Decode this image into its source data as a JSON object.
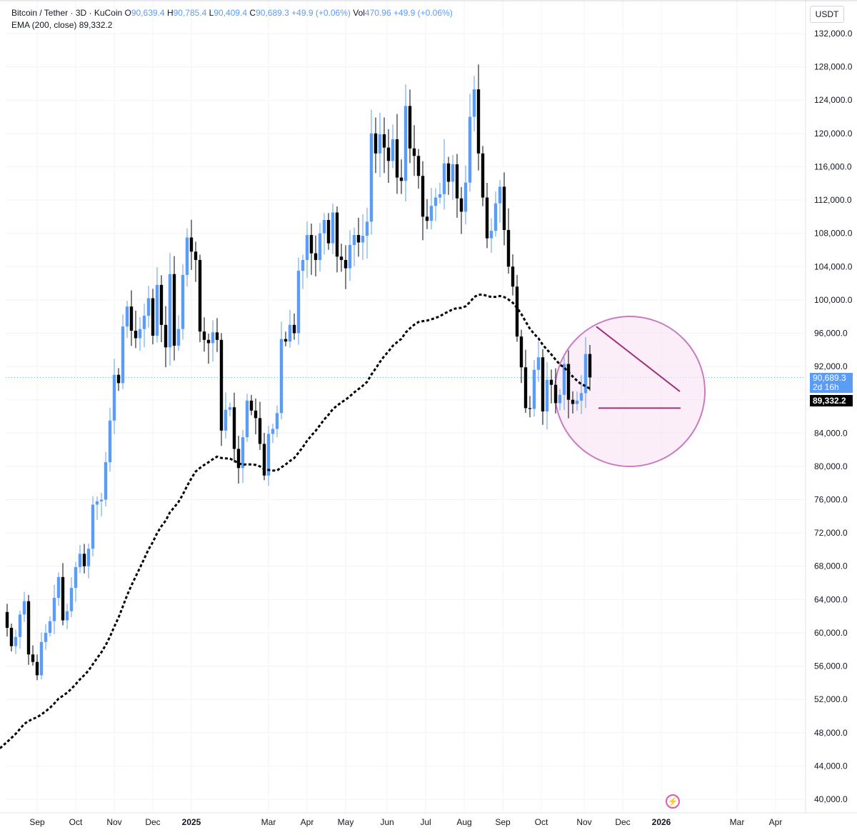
{
  "legend": {
    "symbol": "Bitcoin / Tether · 3D · KuCoin",
    "open_label": "O",
    "open": "90,639.4",
    "high_label": "H",
    "high": "90,785.4",
    "low_label": "L",
    "low": "90,409.4",
    "close_label": "C",
    "close": "90,689.3",
    "change": "+49.9 (+0.06%)",
    "vol_label": "Vol",
    "vol": "470.96",
    "vol_change": "+49.9 (+0.06%)",
    "ema_label": "EMA (200, close)",
    "ema_value": "89,332.2"
  },
  "currency": "USDT",
  "last_price_tag": {
    "price": "90,689.3",
    "countdown": "2d 16h"
  },
  "ema_price_tag": "89,332.2",
  "icons": {
    "lightning": "lightning-icon"
  },
  "chart_data": {
    "type": "candlestick",
    "interval": "3D",
    "ylim": [
      40000,
      132000
    ],
    "y_ticks": [
      "132,000.0",
      "128,000.0",
      "124,000.0",
      "120,000.0",
      "116,000.0",
      "112,000.0",
      "108,000.0",
      "104,000.0",
      "100,000.0",
      "96,000.0",
      "92,000.0",
      "88,000.0",
      "84,000.0",
      "80,000.0",
      "76,000.0",
      "72,000.0",
      "68,000.0",
      "64,000.0",
      "60,000.0",
      "56,000.0",
      "52,000.0",
      "48,000.0",
      "44,000.0",
      "40,000.0"
    ],
    "y_tick_values": [
      132000,
      128000,
      124000,
      120000,
      116000,
      112000,
      108000,
      104000,
      100000,
      96000,
      92000,
      88000,
      84000,
      80000,
      76000,
      72000,
      68000,
      64000,
      60000,
      56000,
      52000,
      48000,
      44000,
      40000
    ],
    "x_ticks": [
      "Sep",
      "Oct",
      "Nov",
      "Dec",
      "2025",
      "Mar",
      "Apr",
      "May",
      "Jun",
      "Jul",
      "Aug",
      "Sep",
      "Oct",
      "Nov",
      "Dec",
      "2026",
      "Mar",
      "Apr"
    ],
    "x_ticks_bold": [
      "2025",
      "2026"
    ],
    "up_color": "#5b9cf6",
    "down_color": "#000000",
    "ema_color": "#000000",
    "annotation_color": "#a0307a",
    "circle_fill": "#f8e0f3",
    "circle_stroke": "#c97bc0",
    "last_price": 90689.3,
    "ema_last": 89332.2,
    "series": [
      {
        "name": "Bitcoin / Tether",
        "closes": [
          60600,
          58400,
          59500,
          62200,
          63800,
          57400,
          56500,
          54900,
          58900,
          60000,
          61400,
          64200,
          66700,
          61500,
          62600,
          65400,
          67900,
          69500,
          68000,
          70100,
          75400,
          75800,
          76000,
          80500,
          85500,
          91000,
          90000,
          96800,
          99200,
          96300,
          95400,
          96500,
          98100,
          100200,
          95700,
          101800,
          97000,
          94300,
          103100,
          94500,
          96500,
          103000,
          107500,
          105800,
          104800,
          96200,
          95200,
          94800,
          96100,
          95200,
          84300,
          86800,
          87100,
          82100,
          79800,
          83500,
          87900,
          86700,
          85800,
          82700,
          78900,
          83900,
          84500,
          86400,
          95300,
          95000,
          97000,
          96000,
          103500,
          104800,
          107800,
          105600,
          104800,
          108000,
          109600,
          106800,
          110500,
          105200,
          104800,
          103800,
          106600,
          107800,
          106900,
          107700,
          109400,
          120000,
          117600,
          119900,
          118300,
          116700,
          119300,
          114700,
          114300,
          123300,
          118200,
          117300,
          114900,
          110000,
          109500,
          111300,
          112300,
          112700,
          116400,
          114200,
          116300,
          112200,
          110600,
          114100,
          122000,
          125300,
          117600,
          112300,
          107400,
          108300,
          111600,
          113600,
          108400,
          104000,
          101600,
          95600,
          91900,
          87000,
          86900,
          91600,
          93100,
          86600,
          90400,
          89800,
          87600,
          88600,
          92300,
          88000,
          87500,
          87900,
          88800,
          93500,
          90689
        ]
      }
    ],
    "ema_200": {
      "name": "EMA (200, close)",
      "start": 46300,
      "end": 89332.2
    },
    "annotations": {
      "descending_trendline": {
        "from": 96800,
        "to": 89000
      },
      "support_line": 87000,
      "highlight_circle": true
    }
  }
}
